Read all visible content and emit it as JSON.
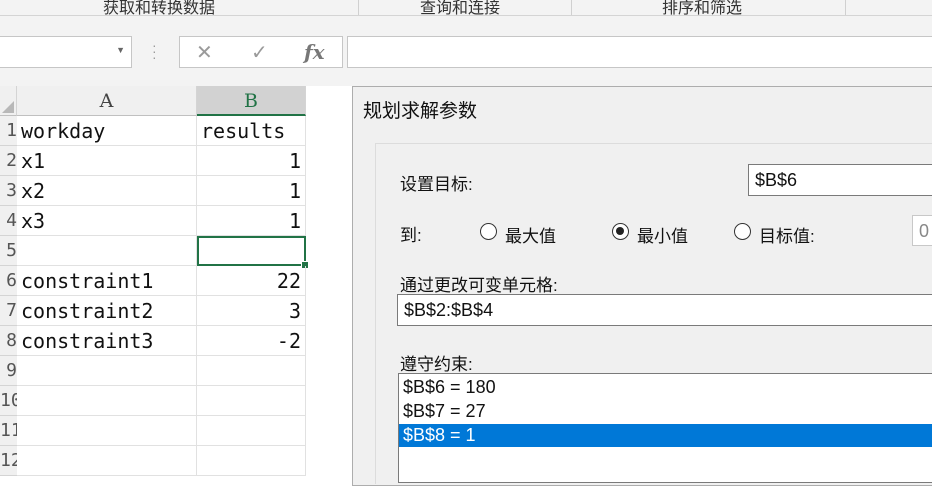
{
  "ribbon": {
    "groups": [
      "获取和转换数据",
      "查询和连接",
      "排序和筛选"
    ]
  },
  "formula_bar": {
    "name_box": "",
    "cancel_glyph": "✕",
    "enter_glyph": "✓",
    "fx_glyph": "fx",
    "formula": ""
  },
  "sheet": {
    "columns": [
      "A",
      "B"
    ],
    "selected_column": "B",
    "row_numbers": [
      "1",
      "2",
      "3",
      "4",
      "5",
      "6",
      "7",
      "8",
      "9",
      "10",
      "11",
      "12"
    ],
    "rows": [
      {
        "a": "workday",
        "b": "results"
      },
      {
        "a": "x1",
        "b": "1"
      },
      {
        "a": "x2",
        "b": "1"
      },
      {
        "a": "x3",
        "b": "1"
      },
      {
        "a": "",
        "b": ""
      },
      {
        "a": "constraint1",
        "b": "22"
      },
      {
        "a": "constraint2",
        "b": "3"
      },
      {
        "a": "constraint3",
        "b": "-2"
      },
      {
        "a": "",
        "b": ""
      },
      {
        "a": "",
        "b": ""
      },
      {
        "a": "",
        "b": ""
      },
      {
        "a": "",
        "b": ""
      }
    ],
    "active_cell": "B5"
  },
  "solver_dialog": {
    "title": "规划求解参数",
    "objective_label": "设置目标:",
    "objective_value": "$B$6",
    "to_label": "到:",
    "options": [
      {
        "label": "最大值",
        "selected": false
      },
      {
        "label": "最小值",
        "selected": true
      },
      {
        "label": "目标值:",
        "selected": false
      }
    ],
    "target_value": "0",
    "changing_cells_label": "通过更改可变单元格:",
    "changing_cells_value": "$B$2:$B$4",
    "constraints_label": "遵守约束:",
    "constraints": [
      "$B$6 = 180",
      "$B$7 = 27",
      "$B$8 = 1"
    ],
    "selected_constraint": 2
  },
  "colors": {
    "excel_green": "#217346",
    "selection_blue": "#0078d7"
  }
}
